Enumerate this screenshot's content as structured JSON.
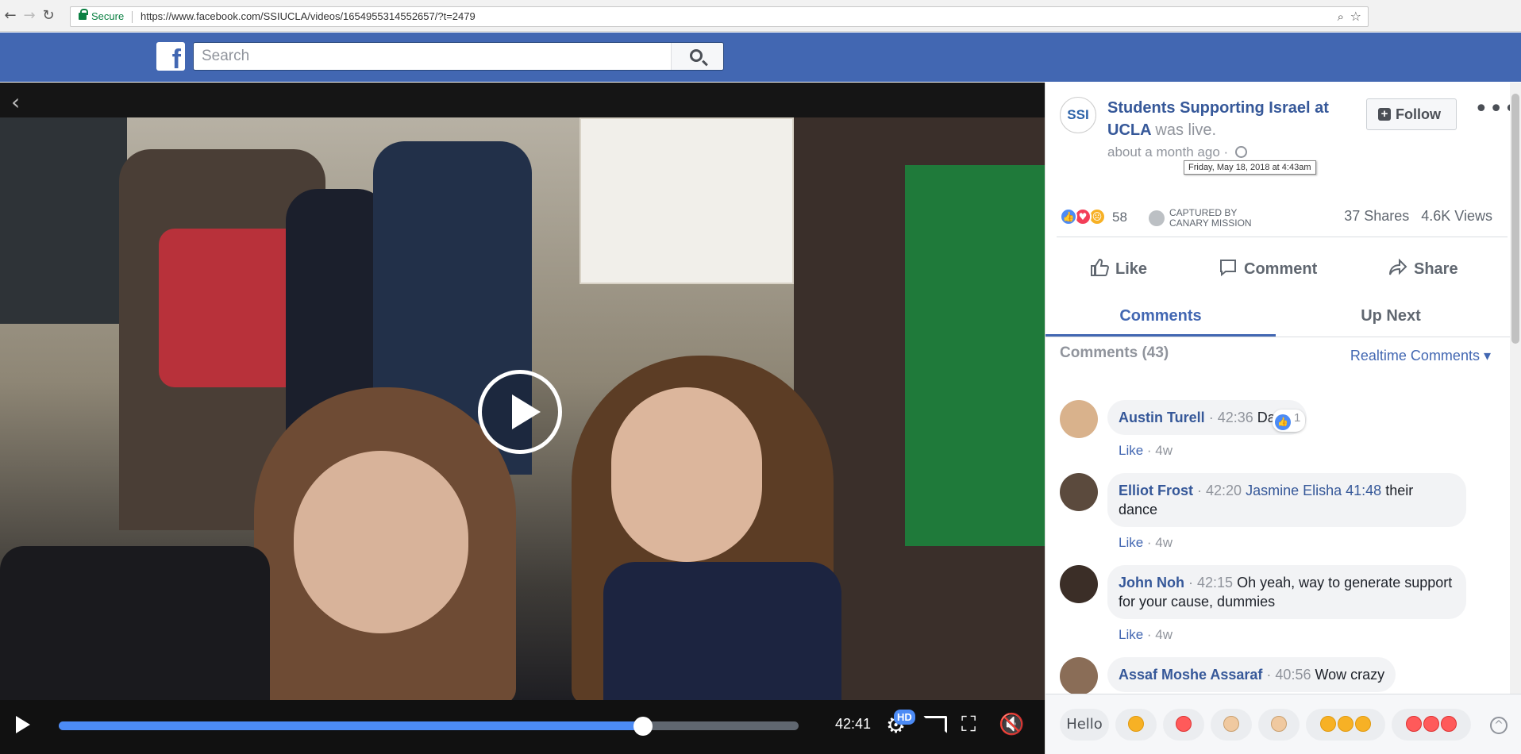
{
  "browser": {
    "secure_label": "Secure",
    "url": "https://www.facebook.com/SSIUCLA/videos/1654955314552657/?t=2479"
  },
  "fb": {
    "logo": "f",
    "search_placeholder": "Search"
  },
  "video": {
    "time": "42:41",
    "progress": 0.79,
    "hd_label": "HD"
  },
  "post": {
    "avatar_text": "SSI",
    "page_name": "Students Supporting Israel at UCLA",
    "status": "was live.",
    "time_ago": "about a month ago",
    "timestamp_tooltip": "Friday, May 18, 2018 at 4:43am",
    "follow_label": "Follow",
    "more_label": "•••",
    "reaction_count": "58",
    "captured_by": "CAPTURED BY",
    "captured_name": "CANARY MISSION",
    "shares": "37 Shares",
    "views": "4.6K Views"
  },
  "actions": {
    "like": "Like",
    "comment": "Comment",
    "share": "Share"
  },
  "tabs": {
    "comments": "Comments",
    "up_next": "Up Next"
  },
  "comments_header": "Comments (43)",
  "realtime_label": "Realtime Comments ▾",
  "comments": [
    {
      "name": "Austin Turell",
      "ts": "42:36",
      "mention": "",
      "text": "Damn",
      "like": "Like",
      "age": "4w",
      "likes": "1"
    },
    {
      "name": "Elliot Frost",
      "ts": "42:20",
      "mention": "Jasmine Elisha 41:48",
      "text": "their dance",
      "like": "Like",
      "age": "4w"
    },
    {
      "name": "John Noh",
      "ts": "42:15",
      "mention": "",
      "text": "Oh yeah, way to generate support for your cause, dummies",
      "like": "Like",
      "age": "4w"
    },
    {
      "name": "Assaf Moshe Assaraf",
      "ts": "40:56",
      "mention": "",
      "text": "Wow crazy",
      "like": "",
      "age": ""
    }
  ],
  "quick_replies": {
    "hello": "Hello"
  },
  "colors": {
    "fb_blue": "#4267b2",
    "link_blue": "#365899",
    "progress_blue": "#4c8bf5"
  }
}
